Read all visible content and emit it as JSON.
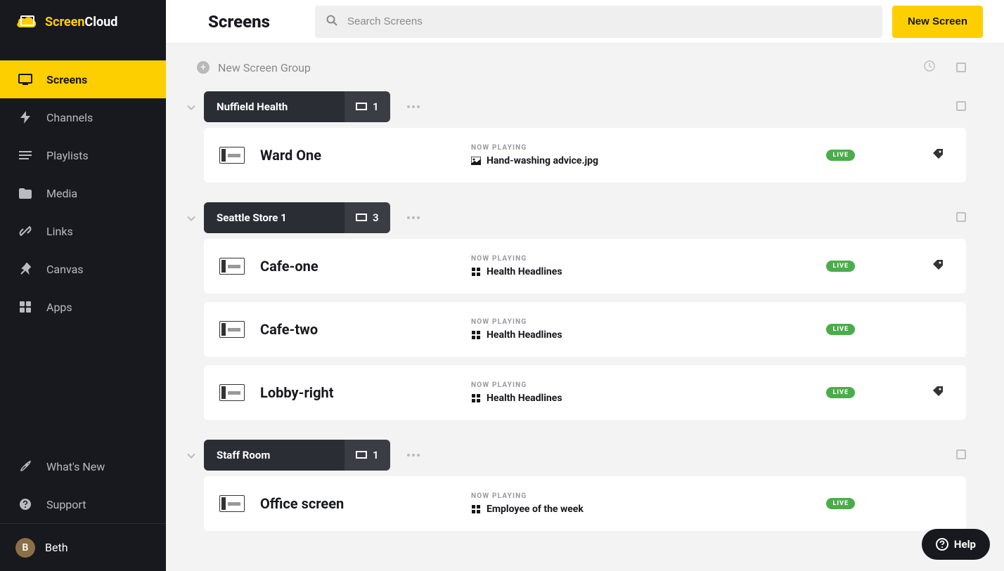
{
  "brand": {
    "name1": "Screen",
    "name2": "Cloud"
  },
  "sidebar": {
    "items": [
      {
        "label": "Screens",
        "active": true,
        "icon": "screen"
      },
      {
        "label": "Channels",
        "active": false,
        "icon": "bolt"
      },
      {
        "label": "Playlists",
        "active": false,
        "icon": "list"
      },
      {
        "label": "Media",
        "active": false,
        "icon": "folder"
      },
      {
        "label": "Links",
        "active": false,
        "icon": "link"
      },
      {
        "label": "Canvas",
        "active": false,
        "icon": "pin"
      },
      {
        "label": "Apps",
        "active": false,
        "icon": "apps"
      }
    ],
    "bottom": [
      {
        "label": "What's New",
        "icon": "rocket"
      },
      {
        "label": "Support",
        "icon": "question"
      }
    ]
  },
  "user": {
    "initial": "B",
    "name": "Beth"
  },
  "page": {
    "title": "Screens"
  },
  "search": {
    "placeholder": "Search Screens"
  },
  "actions": {
    "new_screen": "New Screen"
  },
  "new_group": {
    "label": "New Screen Group"
  },
  "now_playing_label": "NOW PLAYING",
  "live_label": "LIVE",
  "help_label": "Help",
  "groups": [
    {
      "name": "Nuffield Health",
      "count": "1",
      "screens": [
        {
          "name": "Ward One",
          "content": "Hand-washing advice.jpg",
          "content_type": "image",
          "has_tag": true
        }
      ]
    },
    {
      "name": "Seattle Store 1",
      "count": "3",
      "screens": [
        {
          "name": "Cafe-one",
          "content": "Health Headlines",
          "content_type": "app",
          "has_tag": true
        },
        {
          "name": "Cafe-two",
          "content": "Health Headlines",
          "content_type": "app",
          "has_tag": false
        },
        {
          "name": "Lobby-right",
          "content": "Health Headlines",
          "content_type": "app",
          "has_tag": true
        }
      ]
    },
    {
      "name": "Staff Room",
      "count": "1",
      "screens": [
        {
          "name": "Office screen",
          "content": "Employee of the week",
          "content_type": "app",
          "has_tag": false
        }
      ]
    }
  ]
}
